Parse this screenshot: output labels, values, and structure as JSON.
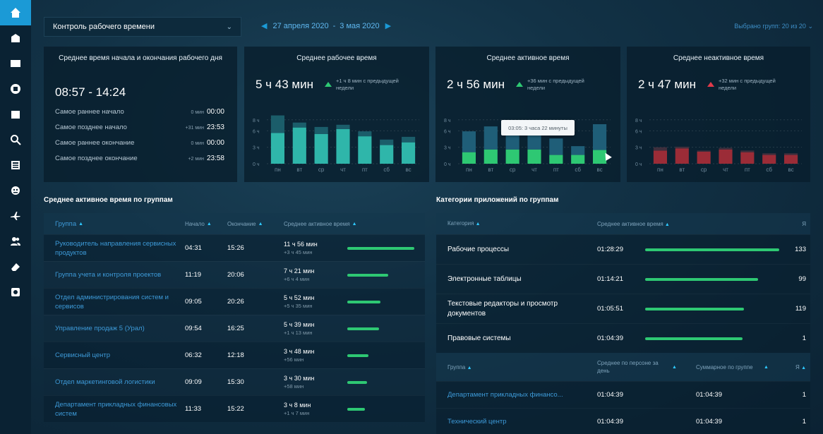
{
  "topbar": {
    "mode": "Контроль рабочего времени",
    "date_from": "27 апреля 2020",
    "date_sep": "-",
    "date_to": "3 мая 2020",
    "groups_selected": "Выбрано групп: 20 из 20"
  },
  "sidebar": {
    "items": [
      {
        "icon": "home-icon"
      },
      {
        "icon": "building-icon"
      },
      {
        "icon": "id-card-icon"
      },
      {
        "icon": "dashboard-icon"
      },
      {
        "icon": "calendar-icon"
      },
      {
        "icon": "search-icon"
      },
      {
        "icon": "list-icon"
      },
      {
        "icon": "robot-icon"
      },
      {
        "icon": "plane-icon"
      },
      {
        "icon": "users-icon"
      },
      {
        "icon": "eraser-icon"
      },
      {
        "icon": "settings-icon"
      }
    ]
  },
  "card_hours": {
    "title": "Среднее время начала и окончания рабочего дня",
    "range": "08:57 - 14:24",
    "rows": [
      {
        "label": "Самое раннее начало",
        "delta": "0 мин",
        "time": "00:00"
      },
      {
        "label": "Самое позднее начало",
        "delta": "+31 мин",
        "time": "23:53"
      },
      {
        "label": "Самое раннее окончание",
        "delta": "0 мин",
        "time": "00:00"
      },
      {
        "label": "Самое позднее окончание",
        "delta": "+2 мин",
        "time": "23:58"
      }
    ]
  },
  "card_work": {
    "title": "Среднее рабочее время",
    "value": "5 ч 43 мин",
    "delta": "+1 ч 8 мин с предыдущей недели"
  },
  "card_active": {
    "title": "Среднее активное время",
    "value": "2 ч 56 мин",
    "delta": "+36 мин с предыдущей недели",
    "tooltip": "03:05: 3 часа 22 минуты"
  },
  "card_inactive": {
    "title": "Среднее неактивное время",
    "value": "2 ч 47 мин",
    "delta": "+32 мин с предыдущей недели"
  },
  "chart_data": [
    {
      "type": "bar",
      "title": "Среднее рабочее время",
      "categories": [
        "пн",
        "вт",
        "ср",
        "чт",
        "пт",
        "сб",
        "вс"
      ],
      "series": [
        {
          "values": [
            5.6,
            6.6,
            5.4,
            6.3,
            5.0,
            3.4,
            3.9
          ]
        },
        {
          "values": [
            3.2,
            0.9,
            1.3,
            0.8,
            0.9,
            1.0,
            1.0
          ]
        }
      ],
      "ytick_labels": [
        "0 ч",
        "3 ч",
        "6 ч",
        "8 ч"
      ],
      "ylim": [
        0,
        9
      ]
    },
    {
      "type": "bar",
      "title": "Среднее активное время",
      "categories": [
        "пн",
        "вт",
        "ср",
        "чт",
        "пт",
        "сб",
        "вс"
      ],
      "series": [
        {
          "values": [
            2.1,
            2.6,
            2.6,
            2.6,
            1.6,
            1.6,
            2.5
          ]
        },
        {
          "values": [
            3.8,
            4.2,
            4.6,
            2.9,
            3.0,
            1.6,
            4.7
          ]
        }
      ],
      "ytick_labels": [
        "0 ч",
        "3 ч",
        "6 ч",
        "8 ч"
      ],
      "ylim": [
        0,
        9
      ]
    },
    {
      "type": "bar",
      "title": "Среднее неактивное время",
      "categories": [
        "пн",
        "вт",
        "ср",
        "чт",
        "пт",
        "сб",
        "вс"
      ],
      "series": [
        {
          "values": [
            2.4,
            2.8,
            2.2,
            2.6,
            2.1,
            1.6,
            1.6
          ]
        },
        {
          "values": [
            0.6,
            0.3,
            0.2,
            0.3,
            0.3,
            0.3,
            0.3
          ]
        }
      ],
      "ytick_labels": [
        "0 ч",
        "3 ч",
        "6 ч",
        "8 ч"
      ],
      "ylim": [
        0,
        9
      ]
    }
  ],
  "groups_table": {
    "title": "Среднее активное время по группам",
    "headers": {
      "group": "Группа",
      "start": "Начало",
      "end": "Окончание",
      "avg": "Среднее активное время"
    },
    "rows": [
      {
        "group": "Руководитель направления сервисных продуктов",
        "start": "04:31",
        "end": "15:26",
        "avg": "11 ч 56 мин",
        "delta": "+3 ч 45 мин",
        "level": 0.95
      },
      {
        "group": "Группа учета и контроля проектов",
        "start": "11:19",
        "end": "20:06",
        "avg": "7 ч 21 мин",
        "delta": "+6 ч 4 мин",
        "level": 0.58
      },
      {
        "group": "Отдел администрирования систем и сервисов",
        "start": "09:05",
        "end": "20:26",
        "avg": "5 ч 52 мин",
        "delta": "+5 ч 35 мин",
        "level": 0.47
      },
      {
        "group": "Управление продаж 5 (Урал)",
        "start": "09:54",
        "end": "16:25",
        "avg": "5 ч 39 мин",
        "delta": "+1 ч 13 мин",
        "level": 0.45
      },
      {
        "group": "Сервисный центр",
        "start": "06:32",
        "end": "12:18",
        "avg": "3 ч 48 мин",
        "delta": "+56 мин",
        "level": 0.3
      },
      {
        "group": "Отдел маркетинговой логистики",
        "start": "09:09",
        "end": "15:30",
        "avg": "3 ч 30 мин",
        "delta": "+58 мин",
        "level": 0.28
      },
      {
        "group": "Департамент прикладных финансовых систем",
        "start": "11:33",
        "end": "15:22",
        "avg": "3 ч 8 мин",
        "delta": "+1 ч 7 мин",
        "level": 0.25
      }
    ]
  },
  "categories_table": {
    "title": "Категории приложений по группам",
    "headers": {
      "category": "Категория",
      "avg": "Среднее активное время",
      "count": "Я"
    },
    "rows": [
      {
        "category": "Рабочие процессы",
        "time": "01:28:29",
        "level": 0.95,
        "count": "133"
      },
      {
        "category": "Электронные таблицы",
        "time": "01:14:21",
        "level": 0.8,
        "count": "99"
      },
      {
        "category": "Текстовые редакторы и просмотр документов",
        "time": "01:05:51",
        "level": 0.7,
        "count": "119"
      },
      {
        "category": "Правовые системы",
        "time": "01:04:39",
        "level": 0.69,
        "count": "1"
      }
    ],
    "sub_headers": {
      "group": "Группа",
      "per_person": "Среднее по персоне за день",
      "total": "Суммарное по группе",
      "count": "Я"
    },
    "sub_rows": [
      {
        "group": "Департамент прикладных финансо...",
        "per_day": "01:04:39",
        "total": "01:04:39",
        "count": "1"
      },
      {
        "group": "Технический центр",
        "per_day": "01:04:39",
        "total": "01:04:39",
        "count": "1"
      }
    ]
  },
  "colors": {
    "accent_blue": "#1b9ad6",
    "bar_teal": "#2fb6aa",
    "bar_green": "#2ec873",
    "bar_red": "#9b2c37",
    "link_blue": "#3d9ad8"
  }
}
